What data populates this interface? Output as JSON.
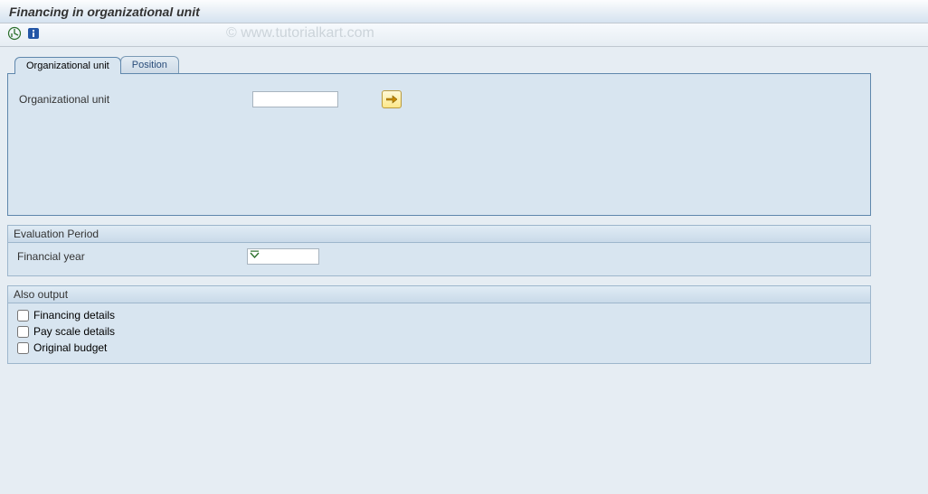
{
  "title": "Financing in organizational unit",
  "watermark": "© www.tutorialkart.com",
  "tabs": [
    {
      "label": "Organizational unit"
    },
    {
      "label": "Position"
    }
  ],
  "orgunit": {
    "label": "Organizational unit",
    "value": ""
  },
  "evaluation": {
    "header": "Evaluation Period",
    "financial_year_label": "Financial year",
    "financial_year_value": ""
  },
  "output": {
    "header": "Also output",
    "items": [
      {
        "label": "Financing details"
      },
      {
        "label": "Pay scale details"
      },
      {
        "label": "Original budget"
      }
    ]
  }
}
